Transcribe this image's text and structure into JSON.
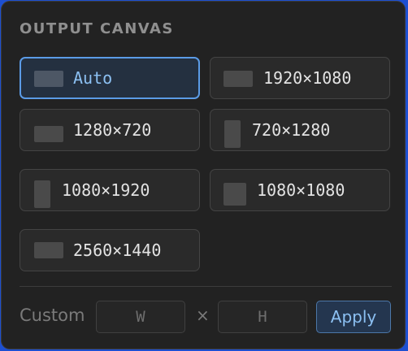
{
  "panel": {
    "heading": "OUTPUT CANVAS",
    "options": [
      {
        "label": "Auto",
        "selected": true
      },
      {
        "label": "1920×1080",
        "selected": false
      },
      {
        "label": "1280×720",
        "selected": false
      },
      {
        "label": "720×1280",
        "selected": false
      },
      {
        "label": "1080×1920",
        "selected": false
      },
      {
        "label": "1080×1080",
        "selected": false
      },
      {
        "label": "2560×1440",
        "selected": false
      }
    ],
    "custom": {
      "label": "Custom",
      "width_placeholder": "W",
      "height_placeholder": "H",
      "separator": "×",
      "apply_label": "Apply"
    }
  },
  "colors": {
    "accent": "#5b9be6",
    "accent_text": "#8cc0f2",
    "panel_bg": "#222222",
    "option_bg": "#2a2a2a"
  }
}
